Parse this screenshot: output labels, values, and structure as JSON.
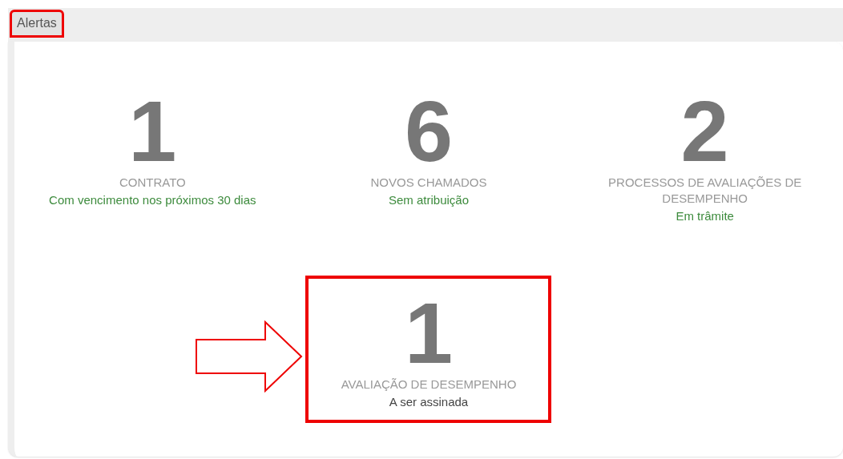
{
  "tab": {
    "label": "Alertas",
    "selected": true,
    "highlighted": true
  },
  "alerts": [
    {
      "count": "1",
      "title": "CONTRATO",
      "subtitle": "Com vencimento nos próximos 30 dias",
      "color": "#3d8b3d"
    },
    {
      "count": "6",
      "title": "NOVOS CHAMADOS",
      "subtitle": "Sem atribuição",
      "color": "#3d8b3d"
    },
    {
      "count": "2",
      "title": "PROCESSOS DE AVALIAÇÕES DE DESEMPENHO",
      "subtitle": "Em trâmite",
      "color": "#3d8b3d"
    },
    {
      "count": "1",
      "title": "AVALIAÇÃO DE DESEMPENHO",
      "subtitle": "A ser assinada",
      "color": "#444444",
      "highlighted": true,
      "pointer_arrow": true
    }
  ]
}
